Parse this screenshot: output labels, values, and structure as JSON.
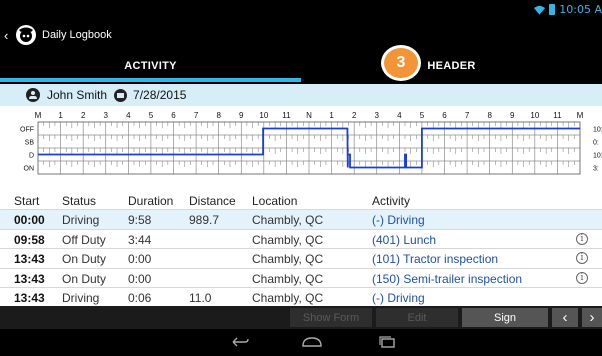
{
  "status_bar": {
    "time": "10:05 A"
  },
  "app": {
    "title": "Daily Logbook"
  },
  "tabs": [
    {
      "label": "ACTIVITY",
      "active": true
    },
    {
      "label": "HEADER",
      "active": false
    }
  ],
  "step_badge": "3",
  "user_bar": {
    "driver": "John Smith",
    "date": "7/28/2015"
  },
  "graph": {
    "hour_labels": [
      "M",
      "1",
      "2",
      "3",
      "4",
      "5",
      "6",
      "7",
      "8",
      "9",
      "10",
      "11",
      "N",
      "1",
      "2",
      "3",
      "4",
      "5",
      "6",
      "7",
      "8",
      "9",
      "10",
      "11",
      "M"
    ],
    "status_rows": [
      "OFF",
      "SB",
      "D",
      "ON"
    ],
    "totals": [
      "10:",
      "0:",
      "10:",
      "3:"
    ],
    "line_color": "#1a3ed9",
    "segments": [
      {
        "status": "D",
        "start_hour": 0.0,
        "end_hour": 9.967
      },
      {
        "status": "OFF",
        "start_hour": 9.967,
        "end_hour": 13.7
      },
      {
        "status": "ON",
        "start_hour": 13.717,
        "end_hour": 13.717
      },
      {
        "status": "D",
        "start_hour": 13.717,
        "end_hour": 13.817
      },
      {
        "status": "ON",
        "start_hour": 13.817,
        "end_hour": 16.25
      },
      {
        "status": "D",
        "start_hour": 16.25,
        "end_hour": 16.3
      },
      {
        "status": "ON",
        "start_hour": 16.3,
        "end_hour": 17.0
      },
      {
        "status": "OFF",
        "start_hour": 17.0,
        "end_hour": 24.0
      }
    ]
  },
  "table": {
    "headers": [
      "Start",
      "Status",
      "Duration",
      "Distance",
      "Location",
      "Activity"
    ],
    "rows": [
      {
        "start": "00:00",
        "status": "Driving",
        "duration": "9:58",
        "distance": "989.7",
        "location": "Chambly, QC",
        "activity": "(-) Driving",
        "info": false
      },
      {
        "start": "09:58",
        "status": "Off Duty",
        "duration": "3:44",
        "distance": "",
        "location": "Chambly, QC",
        "activity": "(401) Lunch",
        "info": true
      },
      {
        "start": "13:43",
        "status": "On Duty",
        "duration": "0:00",
        "distance": "",
        "location": "Chambly, QC",
        "activity": "(101) Tractor inspection",
        "info": true
      },
      {
        "start": "13:43",
        "status": "On Duty",
        "duration": "0:00",
        "distance": "",
        "location": "Chambly, QC",
        "activity": "(150) Semi-trailer inspection",
        "info": true
      },
      {
        "start": "13:43",
        "status": "Driving",
        "duration": "0:06",
        "distance": "11.0",
        "location": "Chambly, QC",
        "activity": "(-) Driving",
        "info": false
      }
    ],
    "info_glyph": "i"
  },
  "bottom_bar": {
    "show_form": "Show Form",
    "edit": "Edit",
    "sign": "Sign",
    "prev": "‹",
    "next": "›"
  },
  "icons": [
    "back-arrow-icon",
    "app-logo-icon",
    "wifi-icon",
    "battery-icon",
    "driver-icon",
    "calendar-icon",
    "info-icon",
    "nav-back-icon",
    "nav-home-icon",
    "nav-recents-icon"
  ]
}
